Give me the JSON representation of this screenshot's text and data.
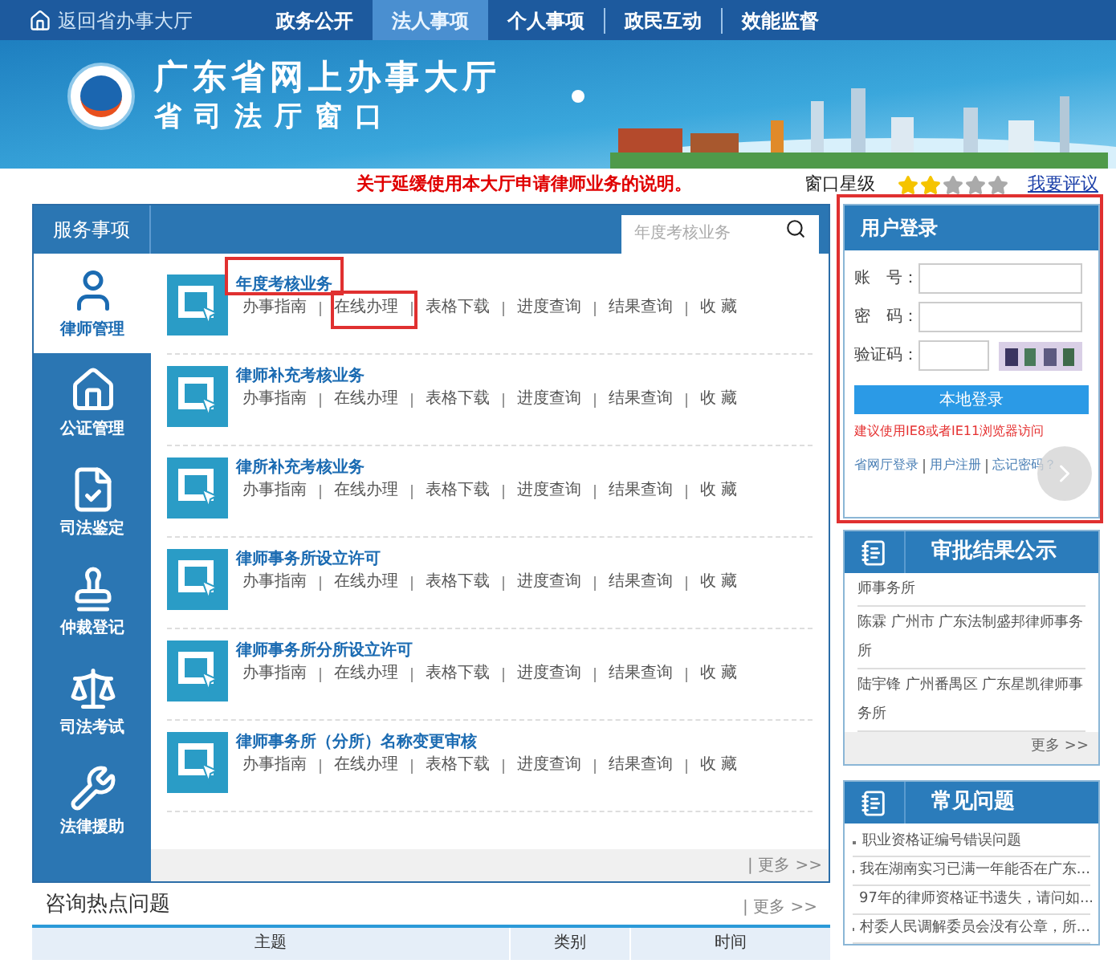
{
  "topbar": {
    "home_link": "返回省办事大厅",
    "tabs": [
      {
        "label": "政务公开",
        "selected": false
      },
      {
        "label": "法人事项",
        "selected": true
      },
      {
        "label": "个人事项",
        "selected": false
      },
      {
        "label": "政民互动",
        "selected": false
      },
      {
        "label": "效能监督",
        "selected": false
      }
    ]
  },
  "banner": {
    "title": "广东省网上办事大厅",
    "subtitle": "省司法厅窗口"
  },
  "notice": "关于延缓使用本大厅申请律师业务的说明。",
  "rating": {
    "label": "窗口星级",
    "stars": 2,
    "link": "我要评议"
  },
  "services": {
    "tab": "服务事项",
    "search": {
      "placeholder": "年度考核业务"
    },
    "categories": [
      {
        "label": "律师管理",
        "selected": true
      },
      {
        "label": "公证管理",
        "selected": false
      },
      {
        "label": "司法鉴定",
        "selected": false
      },
      {
        "label": "仲裁登记",
        "selected": false
      },
      {
        "label": "司法考试",
        "selected": false
      },
      {
        "label": "法律援助",
        "selected": false
      }
    ],
    "items": [
      {
        "title": "年度考核业务",
        "links": [
          "办事指南",
          "在线办理",
          "表格下载",
          "进度查询",
          "结果查询",
          "收 藏"
        ]
      },
      {
        "title": "律师补充考核业务",
        "links": [
          "办事指南",
          "在线办理",
          "表格下载",
          "进度查询",
          "结果查询",
          "收 藏"
        ]
      },
      {
        "title": "律所补充考核业务",
        "links": [
          "办事指南",
          "在线办理",
          "表格下载",
          "进度查询",
          "结果查询",
          "收 藏"
        ]
      },
      {
        "title": "律师事务所设立许可",
        "links": [
          "办事指南",
          "在线办理",
          "表格下载",
          "进度查询",
          "结果查询",
          "收 藏"
        ]
      },
      {
        "title": "律师事务所分所设立许可",
        "links": [
          "办事指南",
          "在线办理",
          "表格下载",
          "进度查询",
          "结果查询",
          "收 藏"
        ]
      },
      {
        "title": "律师事务所（分所）名称变更审核",
        "links": [
          "办事指南",
          "在线办理",
          "表格下载",
          "进度查询",
          "结果查询",
          "收 藏"
        ]
      }
    ],
    "more": "| 更多 >>"
  },
  "hot_questions": {
    "title": "咨询热点问题",
    "more": "| 更多 >>",
    "columns": [
      "主题",
      "类别",
      "时间"
    ]
  },
  "login": {
    "title": "用户登录",
    "fields": [
      {
        "label": "账　号：",
        "kind": "text"
      },
      {
        "label": "密　码：",
        "kind": "password"
      },
      {
        "label": "验证码：",
        "kind": "captcha"
      }
    ],
    "button": "本地登录",
    "hint": "建议使用IE8或者IE11浏览器访问",
    "links": [
      "省网厅登录",
      "用户注册",
      "忘记密码？"
    ]
  },
  "approvals": {
    "title": "审批结果公示",
    "items": [
      "师事务所",
      "陈霖 广州市 广东法制盛邦律师事务所",
      "陆宇锋 广州番禺区 广东星凯律师事务所"
    ],
    "more": "更多 >>"
  },
  "faq": {
    "title": "常见问题",
    "items": [
      "职业资格证编号错误问题",
      "我在湖南实习已满一年能否在广东...",
      "97年的律师资格证书遗失，请问如...",
      "村委人民调解委员会没有公章，所..."
    ]
  }
}
